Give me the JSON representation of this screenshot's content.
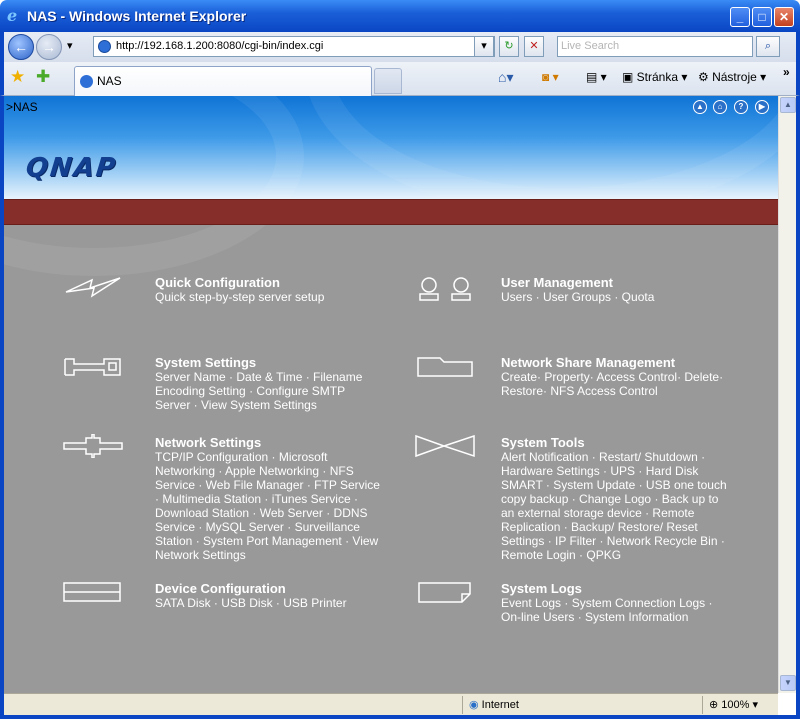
{
  "window": {
    "title": "NAS - Windows Internet Explorer",
    "min": "_",
    "max": "□",
    "close": "✕"
  },
  "nav": {
    "back": "←",
    "forward": "→",
    "history": "▾",
    "url": "http://192.168.1.200:8080/cgi-bin/index.cgi",
    "search_placeholder": "Live Search",
    "refresh": "↻",
    "stop": "✕",
    "search_btn": "⌕"
  },
  "tabs": [
    {
      "label": "NAS"
    }
  ],
  "toolbar": {
    "page_label": "Stránka",
    "tools_label": "Nástroje",
    "more": "»"
  },
  "page": {
    "breadcrumb": ">NAS",
    "logo": "QNAP",
    "header_icons": [
      "up-icon",
      "home-icon",
      "help-icon",
      "logout-icon"
    ],
    "items": [
      {
        "title": "Quick Configuration",
        "desc": "Quick step-by-step server setup",
        "icon": "lightning-icon"
      },
      {
        "title": "User Management",
        "desc": "Users · User Groups · Quota",
        "icon": "users-icon"
      },
      {
        "title": "System Settings",
        "desc": "Server Name · Date & Time · Filename Encoding Setting · Configure SMTP Server · View System Settings",
        "icon": "wrench-icon"
      },
      {
        "title": "Network Share Management",
        "desc": "Create· Property· Access Control· Delete· Restore· NFS Access Control",
        "icon": "folder-icon"
      },
      {
        "title": "Network Settings",
        "desc": "TCP/IP Configuration · Microsoft Networking · Apple Networking · NFS Service · Web File Manager · FTP Service · Multimedia Station · iTunes Service · Download Station · Web Server · DDNS Service · MySQL Server · Surveillance Station · System Port Management · View Network Settings",
        "icon": "network-icon"
      },
      {
        "title": "System Tools",
        "desc": "Alert Notification · Restart/ Shutdown · Hardware Settings · UPS · Hard Disk SMART · System Update · USB one touch copy backup · Change Logo · Back up to an external storage device · Remote Replication · Backup/ Restore/ Reset Settings · IP Filter · Network Recycle Bin · Remote Login · QPKG",
        "icon": "bowtie-icon"
      },
      {
        "title": "Device Configuration",
        "desc": "SATA Disk · USB Disk · USB Printer",
        "icon": "drive-icon"
      },
      {
        "title": "System Logs",
        "desc": "Event Logs · System Connection Logs · On-line Users · System Information",
        "icon": "log-icon"
      }
    ]
  },
  "status": {
    "zone": "Internet",
    "zoom": "100%"
  }
}
